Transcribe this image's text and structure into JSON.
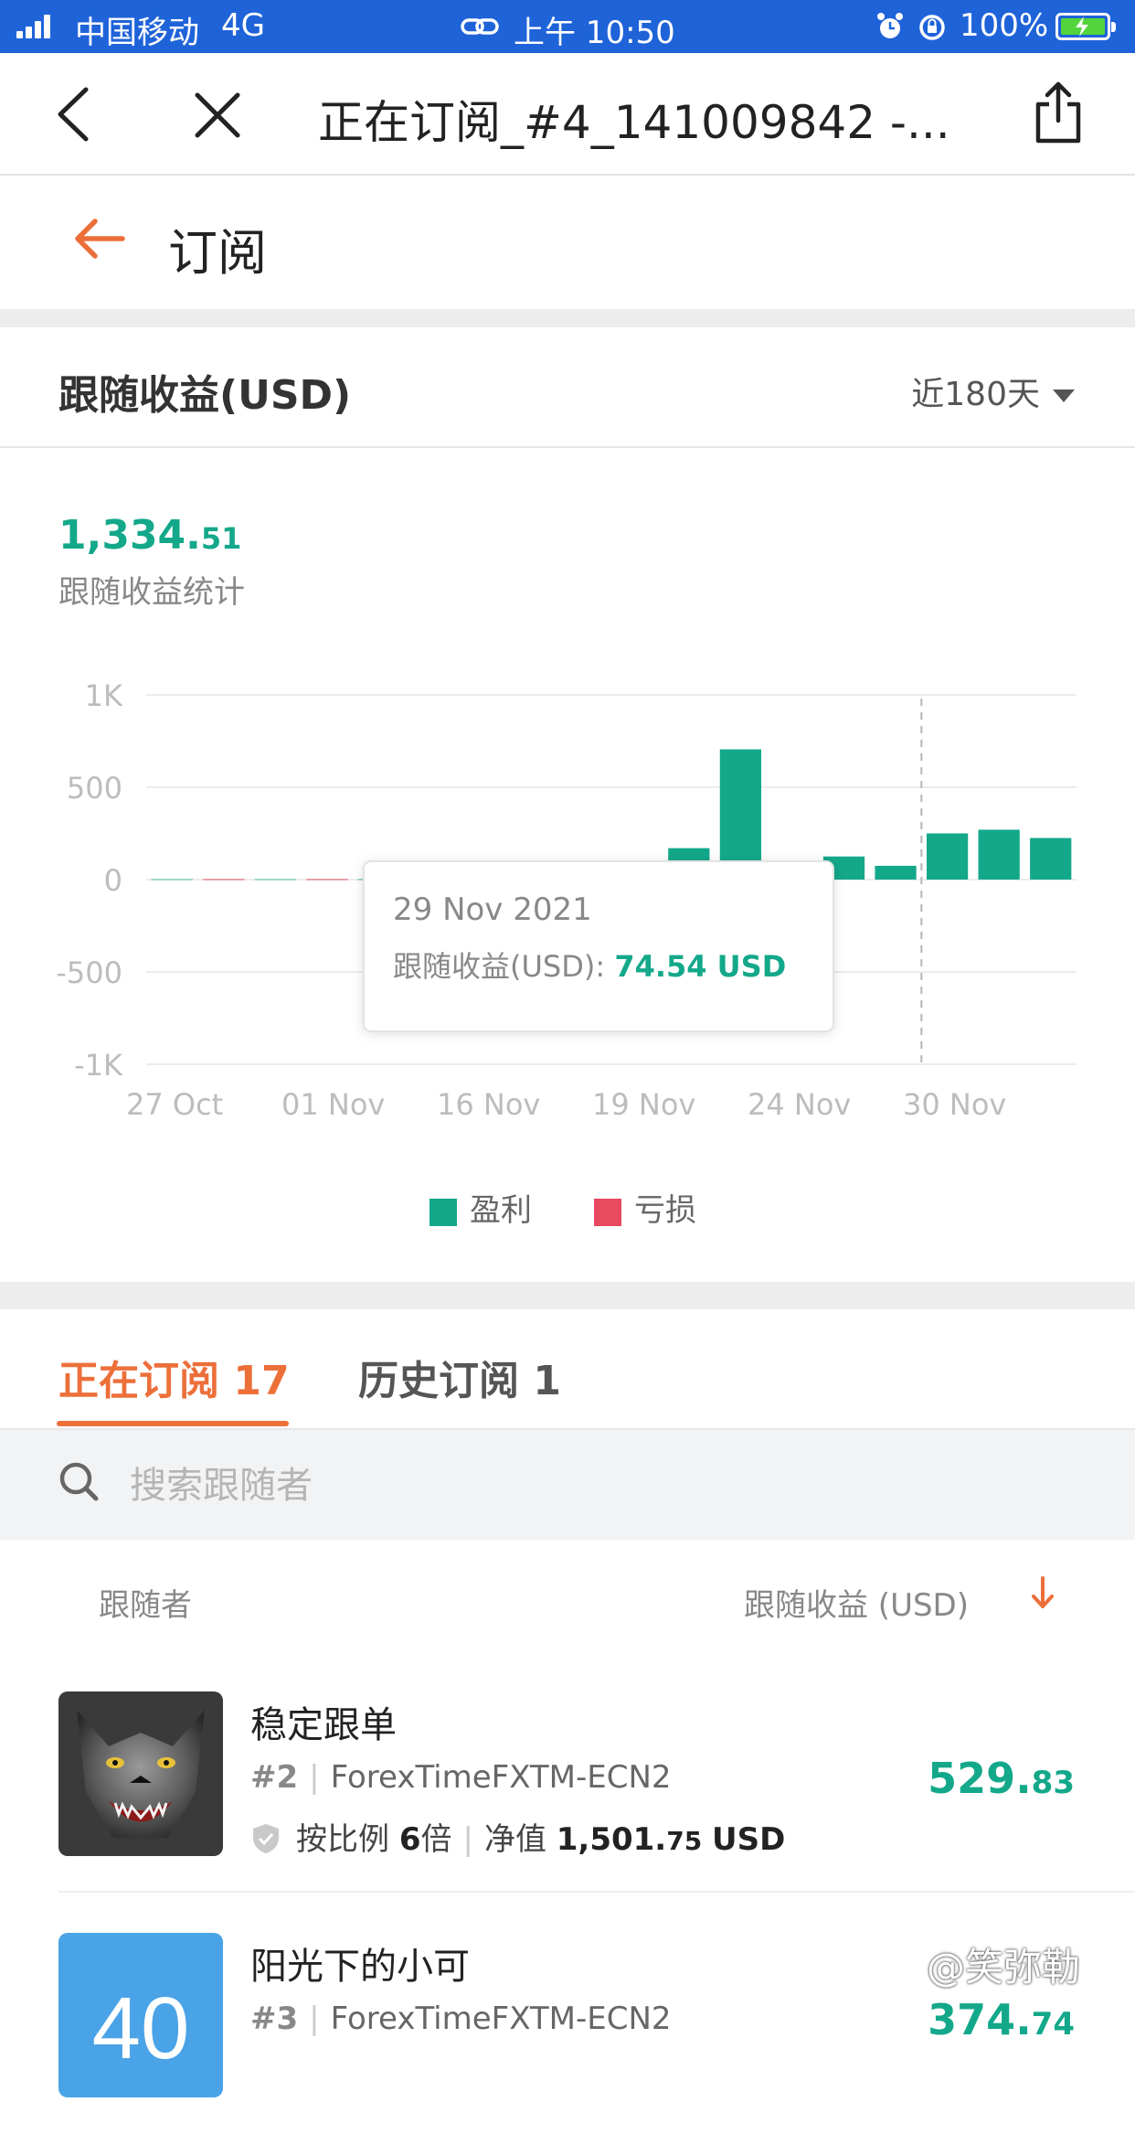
{
  "status_bar": {
    "carrier": "中国移动",
    "network": "4G",
    "time": "上午 10:50",
    "battery": "100%"
  },
  "nav": {
    "title": "正在订阅_#4_141009842 -..."
  },
  "page": {
    "title": "订阅"
  },
  "card": {
    "title": "跟随收益(USD)",
    "period": "近180天",
    "total_int": "1,334.",
    "total_dec": "51",
    "total_label": "跟随收益统计"
  },
  "chart_data": {
    "type": "bar",
    "y_ticks": [
      "1K",
      "500",
      "0",
      "-500",
      "-1K"
    ],
    "x_ticks": [
      "27 Oct",
      "01 Nov",
      "16 Nov",
      "19 Nov",
      "24 Nov",
      "30 Nov"
    ],
    "ylim": [
      -1000,
      1000
    ],
    "grid": true,
    "series": [
      {
        "name": "盈利",
        "color": "#14a88a",
        "values": [
          0,
          0,
          0,
          0,
          0,
          0,
          0,
          0,
          0,
          0,
          170,
          705,
          0,
          125,
          74.54,
          250,
          270,
          225
        ]
      },
      {
        "name": "亏损",
        "color": "#e84a5f",
        "values": [
          0,
          0,
          0,
          0,
          0,
          0,
          0,
          0,
          0,
          0,
          0,
          0,
          0,
          0,
          0,
          0,
          0,
          0
        ]
      }
    ],
    "tooltip": {
      "date": "29 Nov 2021",
      "label": "跟随收益(USD): ",
      "value": "74.54 USD"
    }
  },
  "legend": {
    "profit": "盈利",
    "loss": "亏损"
  },
  "tabs": {
    "active_label": "正在订阅",
    "active_count": "17",
    "inactive_label": "历史订阅",
    "inactive_count": "1"
  },
  "search": {
    "placeholder": "搜索跟随者"
  },
  "list": {
    "col_follower": "跟随者",
    "col_profit": "跟随收益 (USD)",
    "rows": [
      {
        "name": "稳定跟单",
        "rank": "#2",
        "account": "ForexTimeFXTM-ECN2",
        "ratio_label": "按比例",
        "ratio_value": "6",
        "ratio_unit": "倍",
        "equity_label": "净值",
        "equity_int": "1,501.",
        "equity_dec": "75",
        "equity_unit": "USD",
        "profit_int": "529.",
        "profit_dec": "83"
      },
      {
        "name": "阳光下的小可",
        "avatar_text": "40",
        "rank": "#3",
        "account": "ForexTimeFXTM-ECN2",
        "profit_int": "374.",
        "profit_dec": "74"
      }
    ]
  },
  "watermark": "@笑弥勒"
}
